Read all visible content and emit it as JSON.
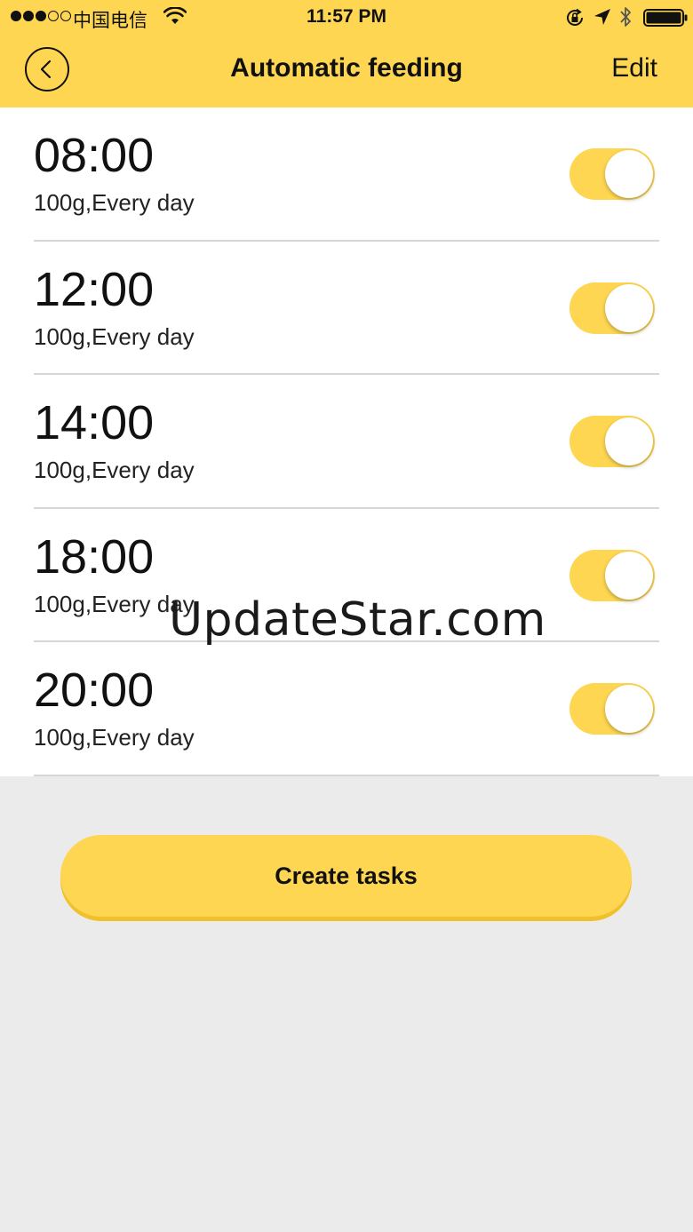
{
  "status_bar": {
    "carrier": "中国电信",
    "time": "11:57 PM",
    "signal_dots": [
      true,
      true,
      true,
      false,
      false
    ]
  },
  "nav": {
    "title": "Automatic feeding",
    "edit_label": "Edit",
    "back_icon": "chevron-left-icon"
  },
  "tasks": [
    {
      "time": "08:00",
      "detail": "100g,Every day",
      "enabled": true
    },
    {
      "time": "12:00",
      "detail": "100g,Every day",
      "enabled": true
    },
    {
      "time": "14:00",
      "detail": "100g,Every day",
      "enabled": true
    },
    {
      "time": "18:00",
      "detail": "100g,Every day",
      "enabled": true
    },
    {
      "time": "20:00",
      "detail": "100g,Every day",
      "enabled": true
    }
  ],
  "create_button_label": "Create tasks",
  "watermark": "UpdateStar.com",
  "colors": {
    "accent": "#fed651",
    "background": "#ebebeb",
    "list_background": "#ffffff"
  }
}
